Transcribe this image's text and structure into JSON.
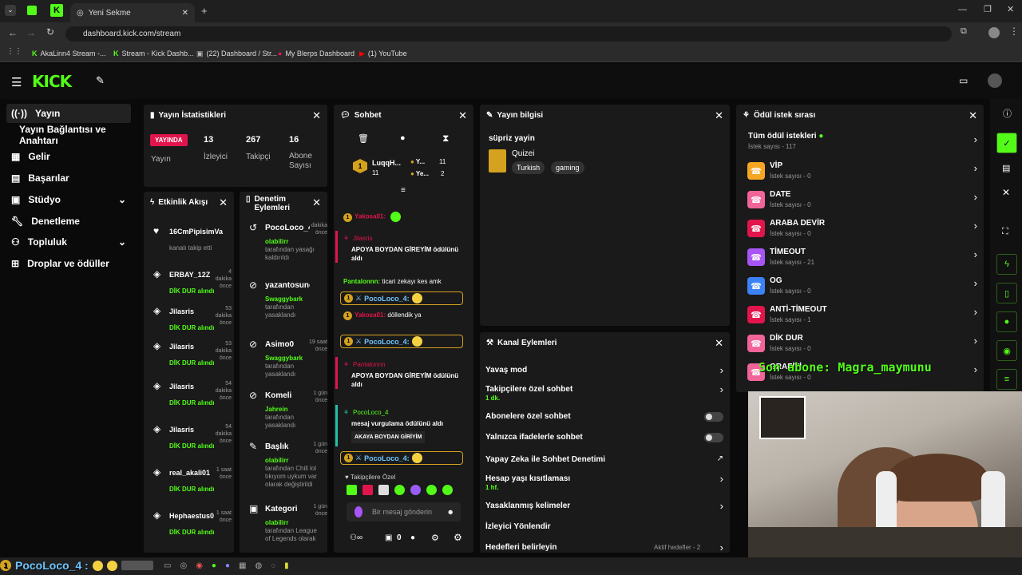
{
  "browser": {
    "tab_title": "Yeni Sekme",
    "url": "dashboard.kick.com/stream",
    "bookmarks": [
      "AkaLinn4 Stream -...",
      "Stream - Kick Dashb...",
      "(22) Dashboard / Str...",
      "My Blerps Dashboard",
      "(1) YouTube"
    ]
  },
  "nav": {
    "items": [
      "Yayın",
      "Yayın Bağlantısı ve Anahtarı",
      "Gelir",
      "Başarılar",
      "Stüdyo",
      "Denetleme",
      "Topluluk",
      "Droplar ve ödüller"
    ]
  },
  "stats": {
    "title": "Yayın İstatistikleri",
    "live_badge": "YAYINDA",
    "live_label": "Yayın",
    "items": [
      {
        "value": "13",
        "label": "İzleyici"
      },
      {
        "value": "267",
        "label": "Takipçi"
      },
      {
        "value": "16",
        "label": "Abone Sayısı"
      }
    ]
  },
  "activity": {
    "title": "Etkinlik Akışı",
    "items": [
      {
        "user": "16CmPipisimVa",
        "detail": "kanalı takip etti",
        "time": ""
      },
      {
        "user": "ERBAY_12Z",
        "detail": "DİK DUR alındı",
        "time": "4 dakika önce"
      },
      {
        "user": "Jilasris",
        "detail": "DİK DUR alındı",
        "time": "53 dakika önce"
      },
      {
        "user": "Jilasris",
        "detail": "DİK DUR alındı",
        "time": "53 dakika önce"
      },
      {
        "user": "Jilasris",
        "detail": "DİK DUR alındı",
        "time": "54 dakika önce"
      },
      {
        "user": "Jilasris",
        "detail": "DİK DUR alındı",
        "time": "54 dakika önce"
      },
      {
        "user": "real_akali01",
        "detail": "DİK DUR alındı",
        "time": "1 saat önce"
      },
      {
        "user": "Hephaestus0",
        "detail": "DİK DUR alındı",
        "time": "1 saat önce"
      }
    ]
  },
  "moderation": {
    "title": "Denetim Eylemleri",
    "items": [
      {
        "user": "PocoLoco_4",
        "by": "olabilirr",
        "detail": "tarafından yasağı kaldırıldı",
        "time": "dakika önce"
      },
      {
        "user": "yazantosunoku",
        "by": "Swaggybark",
        "detail": "tarafından yasaklandı",
        "time": ""
      },
      {
        "user": "Asimo0",
        "by": "Swaggybark",
        "detail": "tarafından yasaklandı",
        "time": "19 saat önce"
      },
      {
        "user": "Komeli",
        "by": "Jahrein",
        "detail": "tarafından yasaklandı",
        "time": "1 gün önce"
      },
      {
        "user": "Başlık",
        "by": "olabilirr",
        "detail": "tarafından Chill lol tıkıyom uykum var olarak değiştirildi",
        "time": "1 gün önce"
      },
      {
        "user": "Kategori",
        "by": "olabilirr",
        "detail": "tarafından League of Legends olarak",
        "time": "1 gün önce"
      }
    ]
  },
  "chat": {
    "title": "Sohbet",
    "top_user": "LuqqH...",
    "top_user_count": "11",
    "top_items": [
      {
        "label": "Y...",
        "count": "11"
      },
      {
        "label": "Ye...",
        "count": "2"
      }
    ],
    "messages": [
      {
        "type": "text",
        "user": "Yakosa01:",
        "text": ""
      },
      {
        "type": "reward",
        "user": "Jilasris",
        "text": "APOYA BOYDAN GİREYİM ödülünü aldı"
      },
      {
        "type": "text",
        "user": "Pantalonnn:",
        "text": "ticari zekayı kes amk"
      },
      {
        "type": "highlight",
        "user": "PocoLoco_4:",
        "text": ""
      },
      {
        "type": "text",
        "user": "Yakosa01:",
        "text": "döllendik ya"
      },
      {
        "type": "highlight",
        "user": "PocoLoco_4:",
        "text": ""
      },
      {
        "type": "reward",
        "user": "Pantalonnn",
        "text": "APOYA BOYDAN GİREYİM ödülünü aldı"
      },
      {
        "type": "reward",
        "user": "PocoLoco_4",
        "text": "mesaj vurgulama ödülünü aldı",
        "extra": "AKAYA BOYDAN GİRİYİM"
      },
      {
        "type": "highlight",
        "user": "PocoLoco_4:",
        "text": ""
      }
    ],
    "followers_only": "Takipçilere Özel",
    "input_placeholder": "Bir mesaj gönderin",
    "footer_count": "0"
  },
  "stream_info": {
    "title": "Yayın bilgisi",
    "stream_title": "süpriz yayin",
    "category": "Quizei",
    "tags": [
      "Turkish",
      "gaming"
    ]
  },
  "channel_actions": {
    "title": "Kanal Eylemleri",
    "items": [
      {
        "label": "Yavaş mod",
        "sub": "",
        "control": "chevron"
      },
      {
        "label": "Takipçilere özel sohbet",
        "sub": "1 dk.",
        "control": "chevron"
      },
      {
        "label": "Abonelere özel sohbet",
        "sub": "",
        "control": "toggle"
      },
      {
        "label": "Yalnızca ifadelerle sohbet",
        "sub": "",
        "control": "toggle"
      },
      {
        "label": "Yapay Zeka ile Sohbet Denetimi",
        "sub": "",
        "control": "link"
      },
      {
        "label": "Hesap yaşı kısıtlaması",
        "sub": "1 hf.",
        "control": "chevron"
      },
      {
        "label": "Yasaklanmış kelimeler",
        "sub": "",
        "control": "chevron"
      },
      {
        "label": "İzleyici Yönlendir",
        "sub": "",
        "control": "none"
      },
      {
        "label": "Hedefleri belirleyin",
        "sub": "",
        "control": "chevron",
        "status": "Aktif hedefler - 2"
      }
    ]
  },
  "rewards": {
    "title": "Ödül istek sırası",
    "all": {
      "label": "Tüm ödül istekleri",
      "count": "İstek sayısı - 117"
    },
    "items": [
      {
        "label": "VİP",
        "count": "İstek sayısı - 0",
        "color": "#f5a623"
      },
      {
        "label": "DATE",
        "count": "İstek sayısı - 0",
        "color": "#f0649a"
      },
      {
        "label": "ARABA DEVİR",
        "count": "İstek sayısı - 0",
        "color": "#e1154c"
      },
      {
        "label": "TİMEOUT",
        "count": "İstek sayısı - 21",
        "color": "#a855f7"
      },
      {
        "label": "OG",
        "count": "İstek sayısı - 0",
        "color": "#3b82f6"
      },
      {
        "label": "ANTİ-TİMEOUT",
        "count": "İstek sayısı - 1",
        "color": "#e1154c"
      },
      {
        "label": "DİK DUR",
        "count": "İstek sayısı - 0",
        "color": "#f0649a"
      },
      {
        "label": "GRAFİTİ",
        "count": "İstek sayısı - 0",
        "color": "#f0649a"
      }
    ]
  },
  "overlay": {
    "sub_text": "Son abone: Magra_maymunu",
    "bottom_user": "PocoLoco_4 :"
  },
  "colors": {
    "brand": "#53fc18",
    "live": "#e1154c",
    "highlight": "#d4a21e"
  }
}
